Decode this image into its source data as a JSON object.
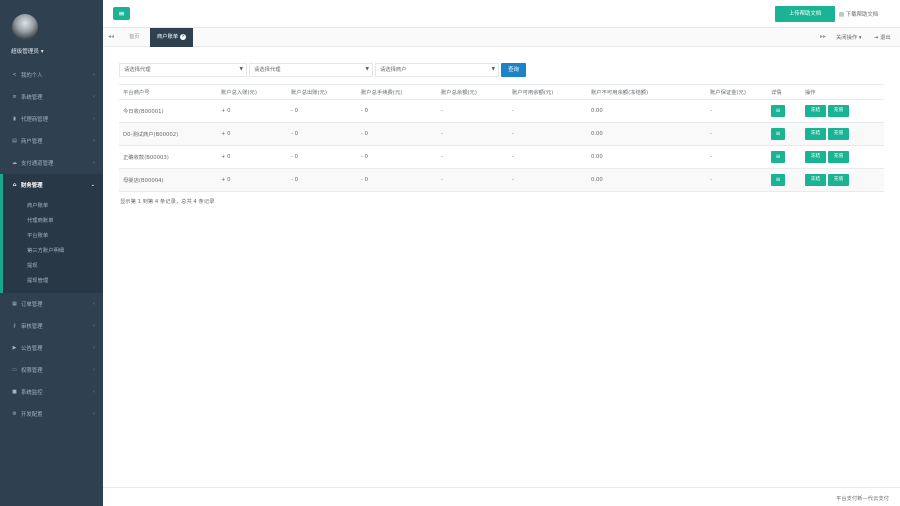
{
  "sidebar": {
    "admin_name": "超级管理员 ▾",
    "nav": [
      {
        "name": "nav-profile",
        "icon": "share-icon",
        "glyph": "<",
        "label": "我的个人"
      },
      {
        "name": "nav-system",
        "icon": "sliders-icon",
        "glyph": "≡",
        "label": "系统管理"
      },
      {
        "name": "nav-agent",
        "icon": "bookmark-icon",
        "glyph": "▮",
        "label": "代理商管理"
      },
      {
        "name": "nav-merchant",
        "icon": "card-icon",
        "glyph": "▤",
        "label": "商户管理"
      },
      {
        "name": "nav-payment",
        "icon": "cloud-icon",
        "glyph": "☁",
        "label": "支付通道管理"
      }
    ],
    "active_nav": {
      "icon": "bank-icon",
      "glyph": "⌂",
      "label": "财务管理"
    },
    "submenu": [
      "商户账单",
      "代理商账单",
      "平台账单",
      "第三方账户明细",
      "提现",
      "提现管理"
    ],
    "nav_bottom": [
      {
        "name": "nav-order",
        "icon": "list-icon",
        "glyph": "▦",
        "label": "订单管理"
      },
      {
        "name": "nav-audit",
        "icon": "key-icon",
        "glyph": "⚷",
        "label": "审核管理"
      },
      {
        "name": "nav-notice",
        "icon": "bullhorn-icon",
        "glyph": "▶",
        "label": "公告管理"
      },
      {
        "name": "nav-permission",
        "icon": "monitor-icon",
        "glyph": "▭",
        "label": "权限管理"
      },
      {
        "name": "nav-monitor",
        "icon": "video-icon",
        "glyph": "■",
        "label": "系统监控"
      },
      {
        "name": "nav-dev",
        "icon": "gear-icon",
        "glyph": "⚙",
        "label": "开发配置"
      }
    ]
  },
  "header": {
    "toggle_glyph": "≡",
    "upload_label": "上传帮助文档",
    "download_label": "▤ 下载帮助文档"
  },
  "tabs": {
    "home": "首页",
    "active": "商户账单",
    "close_glyph": "×",
    "ops": "关闭操作 ▾",
    "exit": "⇥ 退出"
  },
  "filters": {
    "agent1": "请选择代理",
    "agent2": "请选择代理",
    "merchant": "请选择商户",
    "query": "查询"
  },
  "table": {
    "headers": [
      "平台商户号",
      "账户总入账(元)",
      "账户总出账(元)",
      "账户总手续费(元)",
      "账户总余额(元)",
      "账户可用余额(元)",
      "账户不可用余额(冻结额)",
      "账户保证金(元)",
      "详情",
      "操作"
    ],
    "rows": [
      [
        "今日收(B00001)",
        "+ 0",
        "- 0",
        "- 0",
        "-",
        "-",
        "0.00",
        "-"
      ],
      [
        "D0-测试商户(B00002)",
        "+ 0",
        "- 0",
        "- 0",
        "-",
        "-",
        "0.00",
        "-"
      ],
      [
        "正确收款(B00003)",
        "+ 0",
        "- 0",
        "- 0",
        "-",
        "-",
        "0.00",
        "-"
      ],
      [
        "母婴店(B00004)",
        "+ 0",
        "- 0",
        "- 0",
        "-",
        "-",
        "0.00",
        "-"
      ]
    ],
    "detail_glyph": "≡",
    "op_freeze": "冻结",
    "op_recharge": "充值"
  },
  "pager": {
    "info": "显示第 1 到第 4 条记录，总共 4 条记录"
  },
  "footer": {
    "text": "平台支付新—代云支付"
  },
  "colors": {
    "accent": "#1ab394",
    "sidebar": "#2f4050",
    "query": "#1c84c6"
  }
}
